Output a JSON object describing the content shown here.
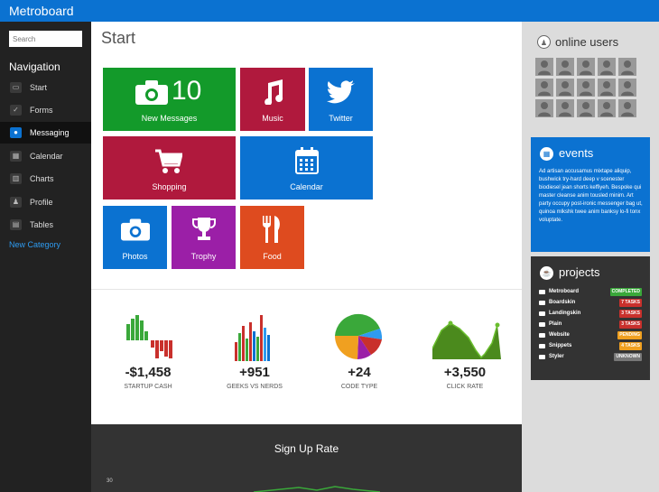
{
  "app": {
    "title": "Metroboard"
  },
  "sidebar": {
    "search_placeholder": "Search",
    "nav_title": "Navigation",
    "items": [
      {
        "label": "Start",
        "icon": "monitor-icon"
      },
      {
        "label": "Forms",
        "icon": "checkbox-icon"
      },
      {
        "label": "Messaging",
        "icon": "chat-bubble-icon",
        "active": true
      },
      {
        "label": "Calendar",
        "icon": "calendar-icon"
      },
      {
        "label": "Charts",
        "icon": "chart-icon"
      },
      {
        "label": "Profile",
        "icon": "user-icon"
      },
      {
        "label": "Tables",
        "icon": "table-icon"
      }
    ],
    "new_category": "New Category"
  },
  "main": {
    "title": "Start",
    "tiles": [
      {
        "label": "New Messages",
        "count": "10",
        "color": "#139a2a",
        "icon": "camera-icon"
      },
      {
        "label": "Music",
        "color": "#b0193d",
        "icon": "music-note-icon"
      },
      {
        "label": "Twitter",
        "color": "#0b72d1",
        "icon": "twitter-bird-icon"
      },
      {
        "label": "Shopping",
        "color": "#b0193d",
        "icon": "shopping-cart-icon"
      },
      {
        "label": "Calendar",
        "color": "#0b72d1",
        "icon": "calendar-icon"
      },
      {
        "label": "Photos",
        "color": "#0b72d1",
        "icon": "camera-icon"
      },
      {
        "label": "Trophy",
        "color": "#9b1fa7",
        "icon": "trophy-icon"
      },
      {
        "label": "Food",
        "color": "#de4b1f",
        "icon": "fork-knife-icon"
      }
    ],
    "stats": [
      {
        "value": "-$1,458",
        "caption": "STARTUP CASH"
      },
      {
        "value": "+951",
        "caption": "GEEKS VS NERDS"
      },
      {
        "value": "+24",
        "caption": "CODE TYPE"
      },
      {
        "value": "+3,550",
        "caption": "CLICK RATE"
      }
    ],
    "signup": {
      "title": "Sign Up Rate",
      "tick": "30"
    }
  },
  "right": {
    "online_users": {
      "title": "online users",
      "count": 15
    },
    "events": {
      "title": "events",
      "text": "Ad artisan accusamus mixtape aliquip, bushwick try-hard deep v scenester biodiesel jean shorts keffiyeh. Bespoke qui master cleanse anim tousled minim. Art party occupy post-ironic messenger bag ut, quinoa mlkshk twee anim banksy lo-fi tonx voluptate."
    },
    "projects": {
      "title": "projects",
      "items": [
        {
          "name": "Metroboard",
          "badge": "COMPLETED",
          "badge_color": "#3aa83a"
        },
        {
          "name": "Boardskin",
          "badge": "7 TASKS",
          "badge_color": "#c9302c"
        },
        {
          "name": "Landingskin",
          "badge": "3 TASKS",
          "badge_color": "#c9302c"
        },
        {
          "name": "Plain",
          "badge": "3 TASKS",
          "badge_color": "#c9302c"
        },
        {
          "name": "Website",
          "badge": "PENDING",
          "badge_color": "#f0a020"
        },
        {
          "name": "Snippets",
          "badge": "4 TASKS",
          "badge_color": "#f0a020"
        },
        {
          "name": "Styler",
          "badge": "UNKNOWN",
          "badge_color": "#777777"
        }
      ]
    }
  }
}
